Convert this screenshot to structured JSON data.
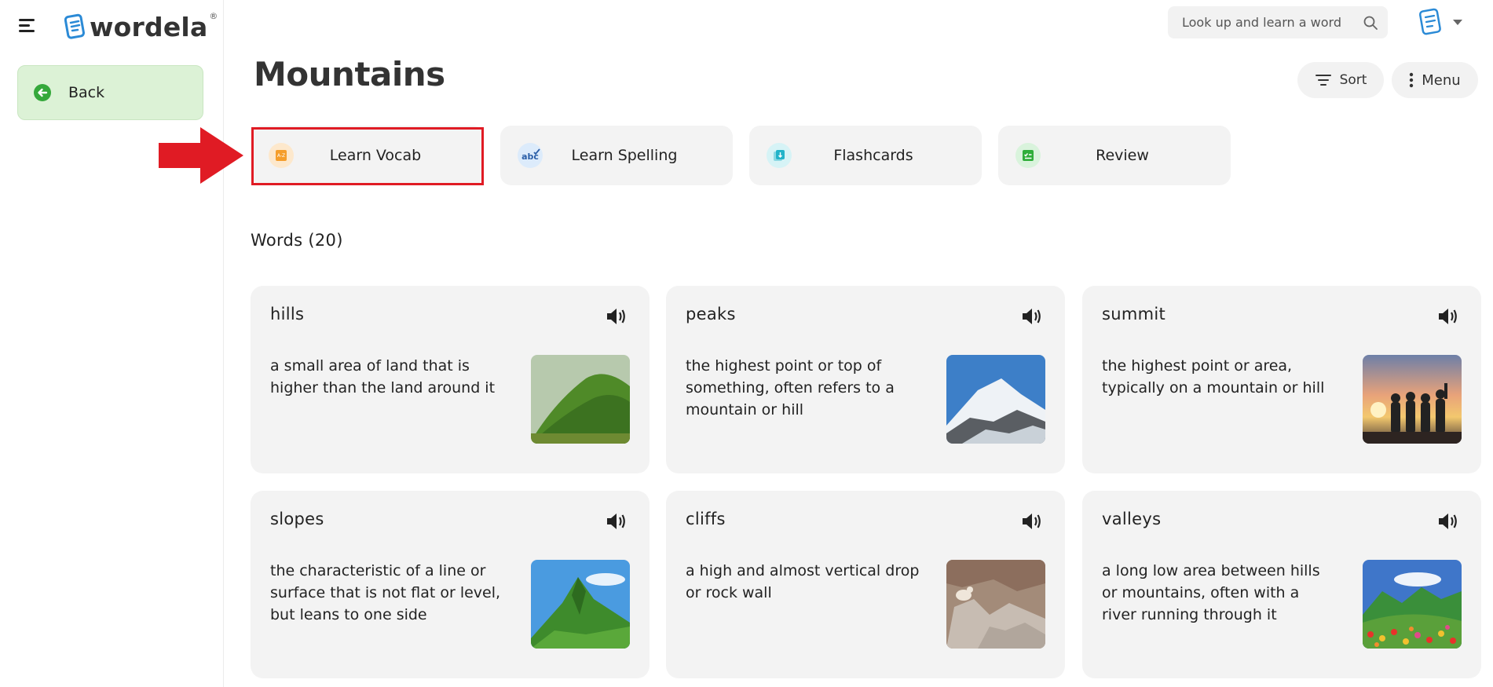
{
  "app": {
    "name": "wordela",
    "trademark": "®"
  },
  "sidebar": {
    "back_label": "Back"
  },
  "search": {
    "placeholder": "Look up and learn a word"
  },
  "page": {
    "title": "Mountains",
    "sort_label": "Sort",
    "menu_label": "Menu"
  },
  "activities": [
    {
      "label": "Learn Vocab",
      "icon": "book-az-icon",
      "color": "#f59e2b"
    },
    {
      "label": "Learn Spelling",
      "icon": "spelling-abc-icon",
      "color": "#2b7fd6"
    },
    {
      "label": "Flashcards",
      "icon": "flashcards-icon",
      "color": "#22b3c9"
    },
    {
      "label": "Review",
      "icon": "review-checklist-icon",
      "color": "#2fae3a"
    }
  ],
  "words_heading": "Words (20)",
  "words": [
    {
      "word": "hills",
      "definition": "a small area of land that is higher than the land around it",
      "image": "green-hill"
    },
    {
      "word": "peaks",
      "definition": "the highest point or top of something, often refers to a mountain or hill",
      "image": "snowy-peak"
    },
    {
      "word": "summit",
      "definition": "the highest point or area, typically on a mountain or hill",
      "image": "summit-sunset-people"
    },
    {
      "word": "slopes",
      "definition": "the characteristic of a line or surface that is not flat or level, but leans to one side",
      "image": "green-mountain"
    },
    {
      "word": "cliffs",
      "definition": "a high and almost vertical drop or rock wall",
      "image": "rocky-cliff-goat"
    },
    {
      "word": "valleys",
      "definition": "a long low area between hills or mountains, often with a river running through it",
      "image": "flower-valley"
    }
  ],
  "colors": {
    "accent_green": "#35a83b",
    "highlight_red": "#e01b24",
    "logo_blue": "#2b8ad6"
  }
}
